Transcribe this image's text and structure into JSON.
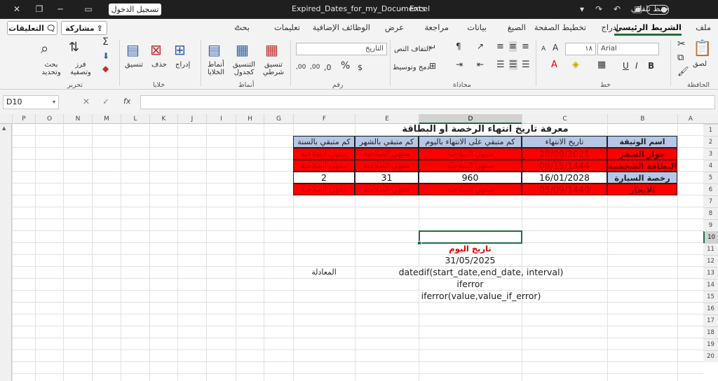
{
  "titlebar": {
    "autosave": "حفظ تلقائي",
    "filename": "Expired_Dates_for_my_Documents",
    "sep": "-",
    "app": "Excel",
    "signin": "تسجيل الدخول"
  },
  "tabs": [
    "ملف",
    "الشريط الرئيسي",
    "إدراج",
    "تخطيط الصفحة",
    "الصيغ",
    "بيانات",
    "مراجعة",
    "عرض",
    "الوظائف الإضافية",
    "تعليمات",
    "بحث"
  ],
  "share_label": "مشاركة",
  "comments_label": "التعليقات",
  "ribbon": {
    "clipboard": {
      "label": "الحافظة",
      "paste": "لصق"
    },
    "font": {
      "label": "خط",
      "name": "Arial",
      "size": "١٨",
      "u": "U",
      "i": "I",
      "b": "B",
      "grow": "A",
      "shrink": "A"
    },
    "alignment": {
      "label": "محاذاة",
      "wrap": "التفاف النص",
      "merge": "دمج وتوسيط"
    },
    "number": {
      "label": "رقم",
      "format": "التاريخ",
      "percent": "%",
      "inc": ",00",
      "dec": ",0"
    },
    "styles": {
      "label": "أنماط",
      "cond": "تنسيق شرطي",
      "table": "التنسيق كجدول",
      "cell": "أنماط الخلايا"
    },
    "cells": {
      "label": "خلايا",
      "insert": "إدراج",
      "delete": "حذف",
      "format": "تنسيق"
    },
    "editing": {
      "label": "تحرير",
      "sort": "فرز وتصفية",
      "find": "بحث وتحديد",
      "sum": "Σ"
    }
  },
  "formula_bar": {
    "namebox": "D10",
    "fx": "fx",
    "value": ""
  },
  "columns": [
    "A",
    "B",
    "C",
    "D",
    "E",
    "F",
    "G",
    "H",
    "I",
    "J",
    "K",
    "L",
    "M",
    "N",
    "O",
    "P"
  ],
  "rows": [
    "1",
    "2",
    "3",
    "4",
    "5",
    "6",
    "7",
    "8",
    "9",
    "10",
    "11",
    "12",
    "13",
    "14",
    "15",
    "16",
    "17",
    "18",
    "19",
    "20"
  ],
  "selected_cell": "D10",
  "sheet": {
    "title": "معرفة تاريخ انتهاء الرخصة أو البطاقة",
    "headers": [
      "اسم الوثيقة",
      "تاريخ الانتهاء",
      "كم متبقي على الانتهاء باليوم",
      "كم متبقي بالشهر",
      "كم متبقي بالسنة"
    ],
    "rows": [
      [
        "جواز السفر",
        "28/09/2021",
        "منتهي الصلاحية",
        "منتهي الصلاحية",
        "منتهي الصلاحية"
      ],
      [
        "البطاقة الشخصية",
        "09/15/1444",
        "منتهي الصلاحية",
        "منتهي الصلاحية",
        "منتهي الصلاحية"
      ],
      [
        "رخصة السيارة",
        "16/01/2028",
        "960",
        "31",
        "2"
      ],
      [
        "الايجار",
        "05/09/1440",
        "منتهي الصلاحية",
        "منتهي الصلاحية",
        "منتهي الصلاحية"
      ]
    ],
    "today_label": "تاريخ اليوم",
    "today_value": "31/05/2025",
    "formula_label": "المعادلة",
    "notes": [
      "datedif(start_date,end_date, interval)",
      "iferror",
      "iferror(value,value_if_error)"
    ]
  },
  "colors": {
    "accent": "#1e6e3e",
    "header_fill": "#b4c7e7",
    "expired_fill": "#ff0000"
  }
}
